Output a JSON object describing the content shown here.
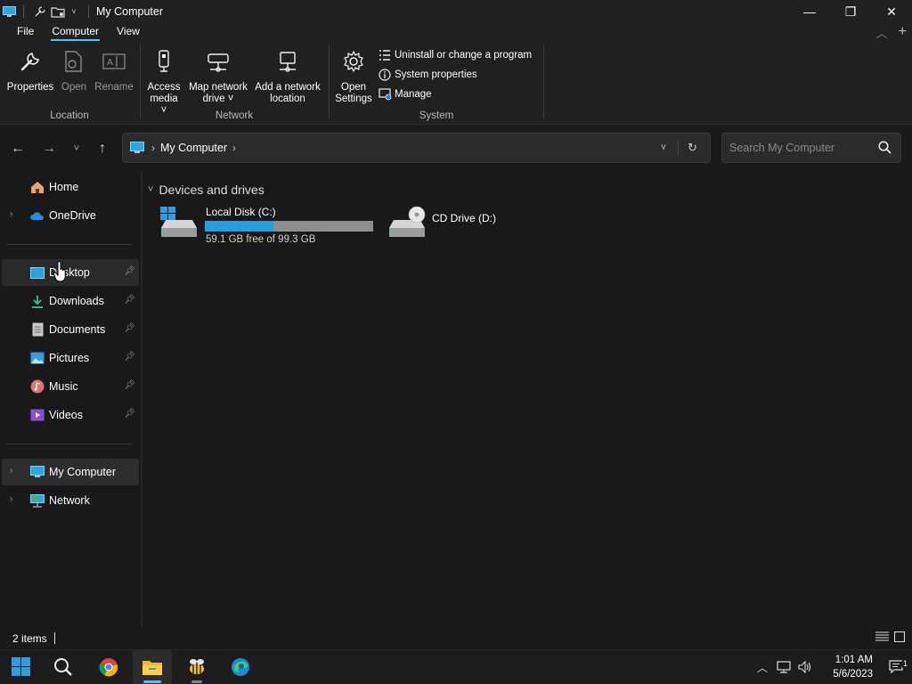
{
  "window": {
    "title": "My Computer",
    "minimize_symbol": "—",
    "restore_symbol": "❐",
    "close_symbol": "✕"
  },
  "menu": {
    "tabs": [
      {
        "label": "File",
        "active": false
      },
      {
        "label": "Computer",
        "active": true
      },
      {
        "label": "View",
        "active": false
      }
    ]
  },
  "ribbon": {
    "location": {
      "label": "Location",
      "buttons": [
        {
          "label": "Properties",
          "icon": "wrench-icon",
          "enabled": true
        },
        {
          "label": "Open",
          "icon": "open-icon",
          "enabled": false
        },
        {
          "label": "Rename",
          "icon": "rename-icon",
          "enabled": false
        }
      ]
    },
    "network": {
      "label": "Network",
      "buttons": [
        {
          "label_line1": "Access",
          "label_line2": "media ˅",
          "icon": "media-device-icon"
        },
        {
          "label_line1": "Map network",
          "label_line2": "drive ˅",
          "icon": "network-drive-icon"
        },
        {
          "label_line1": "Add a network",
          "label_line2": "location",
          "icon": "network-location-icon"
        }
      ]
    },
    "system": {
      "label": "System",
      "open_settings_line1": "Open",
      "open_settings_line2": "Settings",
      "small_buttons": [
        {
          "label": "Uninstall or change a program",
          "icon": "programs-list-icon"
        },
        {
          "label": "System properties",
          "icon": "info-icon"
        },
        {
          "label": "Manage",
          "icon": "manage-icon"
        }
      ]
    }
  },
  "address_bar": {
    "crumb": "My Computer",
    "search_placeholder": "Search My Computer"
  },
  "sidebar": {
    "items": [
      {
        "label": "Home",
        "icon": "home-icon"
      },
      {
        "label": "OneDrive",
        "icon": "onedrive-icon"
      },
      {
        "label": "Desktop",
        "icon": "desktop-icon",
        "pinned": true
      },
      {
        "label": "Downloads",
        "icon": "downloads-icon",
        "pinned": true
      },
      {
        "label": "Documents",
        "icon": "documents-icon",
        "pinned": true
      },
      {
        "label": "Pictures",
        "icon": "pictures-icon",
        "pinned": true
      },
      {
        "label": "Music",
        "icon": "music-icon",
        "pinned": true
      },
      {
        "label": "Videos",
        "icon": "videos-icon",
        "pinned": true
      },
      {
        "label": "My Computer",
        "icon": "computer-icon",
        "selected": true
      },
      {
        "label": "Network",
        "icon": "network-icon"
      }
    ]
  },
  "content": {
    "group_title": "Devices and drives",
    "drives": [
      {
        "name": "Local Disk (C:)",
        "free_text": "59.1 GB free of 99.3 GB",
        "used_fraction": 0.405,
        "icon": "windows-drive-icon"
      },
      {
        "name": "CD Drive (D:)",
        "icon": "cd-drive-icon"
      }
    ]
  },
  "status": {
    "item_count": "2 items"
  },
  "taskbar": {
    "apps": [
      "start-icon",
      "search-icon",
      "chrome-icon",
      "file-explorer-icon",
      "bee-app-icon",
      "edge-icon"
    ],
    "time": "1:01 AM",
    "date": "5/6/2023",
    "notification_count": "1"
  },
  "colors": {
    "accent": "#4cc2ff",
    "drive_bar_fill": "#26a0da",
    "drive_bar_bg": "#8e8e8e",
    "background": "#191919",
    "chrome": "#202020"
  }
}
